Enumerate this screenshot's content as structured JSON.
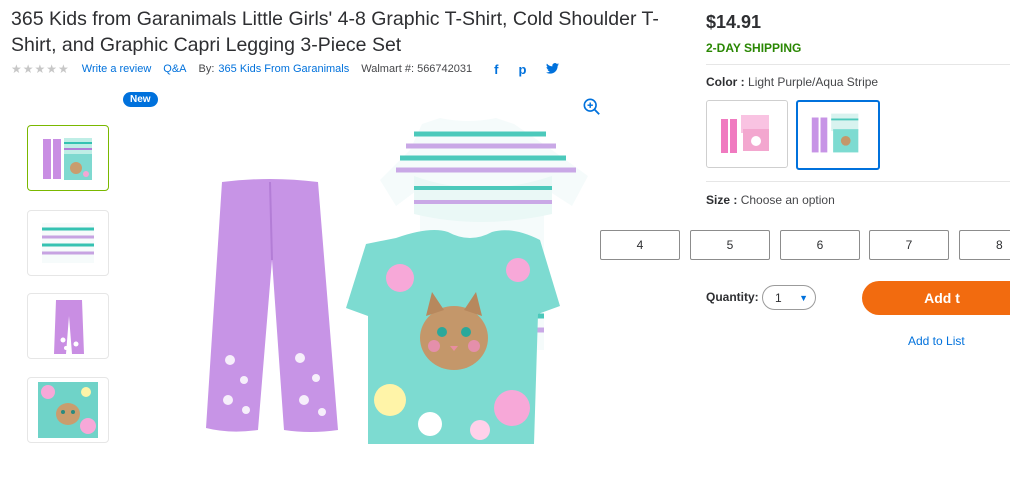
{
  "product": {
    "title": "365 Kids from Garanimals Little Girls' 4-8 Graphic T-Shirt, Cold Shoulder T-Shirt, and Graphic Capri Legging 3-Piece Set",
    "rating_stars": "★★★★★",
    "write_review": "Write a review",
    "qa": "Q&A",
    "by_label": "By:",
    "brand": "365 Kids From Garanimals",
    "walmart_number": "Walmart #: 566742031",
    "share_icons": [
      "facebook-icon",
      "pinterest-icon",
      "twitter-icon"
    ]
  },
  "gallery": {
    "badge": "New",
    "thumbnails": [
      "set",
      "ruffle-shirt",
      "leggings",
      "kitten-shirt"
    ]
  },
  "buy_box": {
    "price": "$14.91",
    "shipping": "2-DAY SHIPPING",
    "color_label": "Color :",
    "color_value": "Light Purple/Aqua Stripe",
    "size_label": "Size :",
    "size_value": "Choose an option",
    "sizes": [
      "4",
      "5",
      "6",
      "7",
      "8"
    ],
    "quantity_label": "Quantity:",
    "quantity_value": "1",
    "add_button": "Add t",
    "add_to_list": "Add to List"
  },
  "colors": {
    "accent": "#0071dc",
    "ship_green": "#2a8703",
    "add_orange": "#f26b0f",
    "selected_thumb": "#7ab800"
  }
}
